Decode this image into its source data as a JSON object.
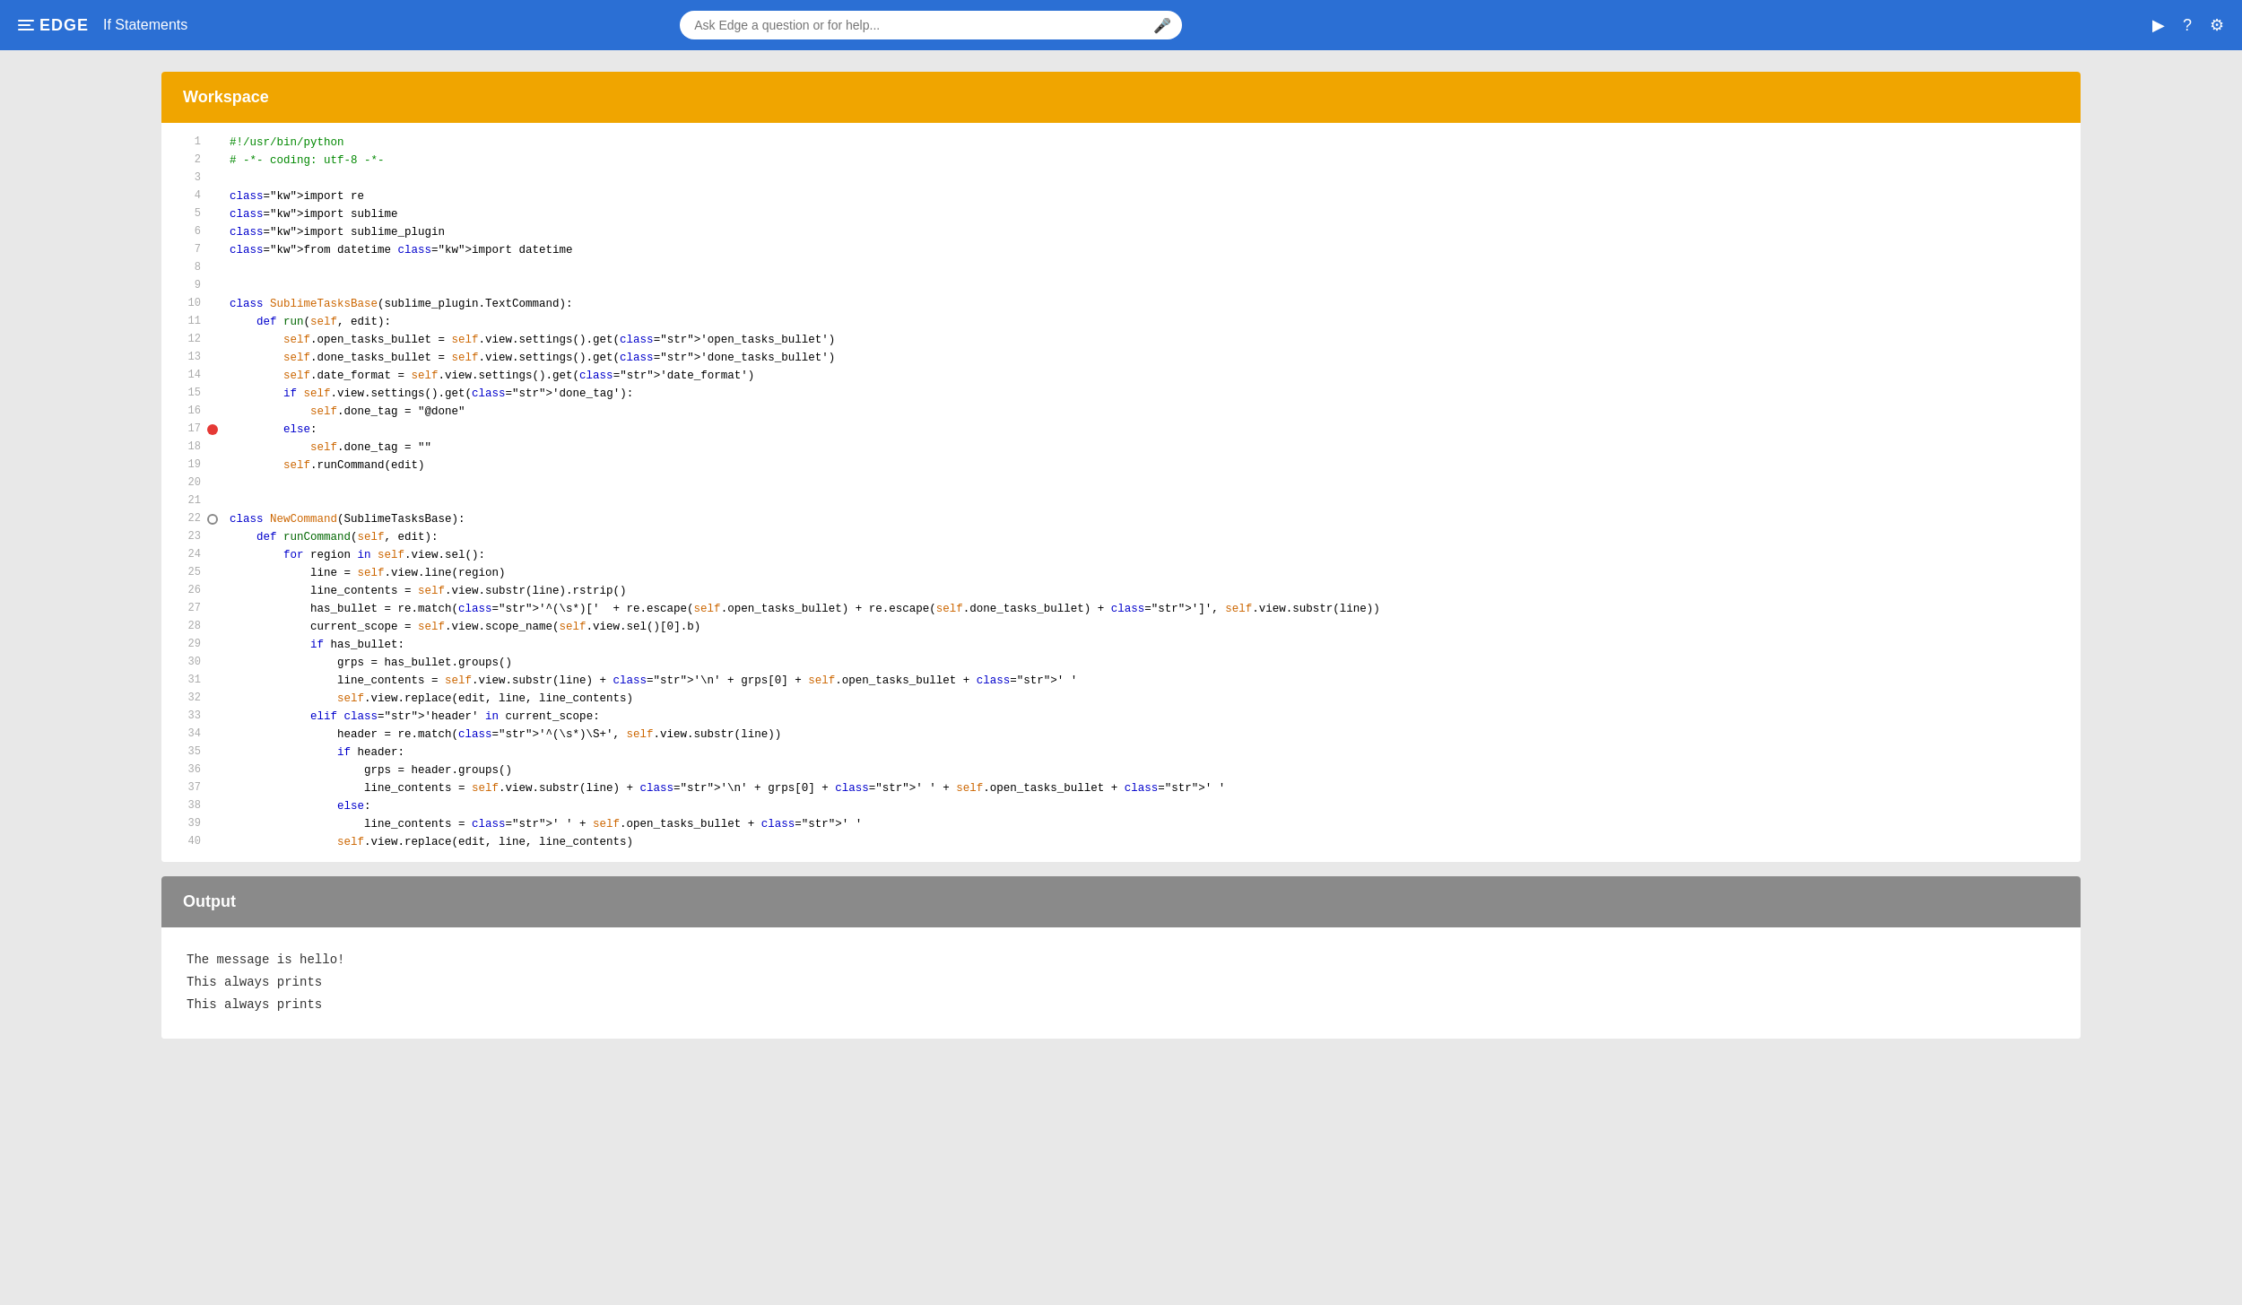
{
  "header": {
    "logo_text": "EDGE",
    "title": "If Statements",
    "search_placeholder": "Ask Edge a question or for help...",
    "play_icon": "▶",
    "help_icon": "?",
    "settings_icon": "⚙"
  },
  "workspace": {
    "panel_title": "Workspace"
  },
  "output": {
    "panel_title": "Output",
    "lines": [
      "The message is hello!",
      "This always prints",
      "This always prints"
    ]
  },
  "code": {
    "lines": [
      {
        "num": 1,
        "icon": null,
        "content": "#!/usr/bin/python"
      },
      {
        "num": 2,
        "icon": null,
        "content": "# -*- coding: utf-8 -*-"
      },
      {
        "num": 3,
        "icon": null,
        "content": ""
      },
      {
        "num": 4,
        "icon": null,
        "content": "import re"
      },
      {
        "num": 5,
        "icon": null,
        "content": "import sublime"
      },
      {
        "num": 6,
        "icon": null,
        "content": "import sublime_plugin"
      },
      {
        "num": 7,
        "icon": null,
        "content": "from datetime import datetime"
      },
      {
        "num": 8,
        "icon": null,
        "content": ""
      },
      {
        "num": 9,
        "icon": null,
        "content": ""
      },
      {
        "num": 10,
        "icon": null,
        "content": "class SublimeTasksBase(sublime_plugin.TextCommand):"
      },
      {
        "num": 11,
        "icon": null,
        "content": "    def run(self, edit):"
      },
      {
        "num": 12,
        "icon": null,
        "content": "        self.open_tasks_bullet = self.view.settings().get('open_tasks_bullet')"
      },
      {
        "num": 13,
        "icon": null,
        "content": "        self.done_tasks_bullet = self.view.settings().get('done_tasks_bullet')"
      },
      {
        "num": 14,
        "icon": null,
        "content": "        self.date_format = self.view.settings().get('date_format')"
      },
      {
        "num": 15,
        "icon": null,
        "content": "        if self.view.settings().get('done_tag'):"
      },
      {
        "num": 16,
        "icon": null,
        "content": "            self.done_tag = \"@done\""
      },
      {
        "num": 17,
        "icon": "breakpoint",
        "content": "        else:"
      },
      {
        "num": 18,
        "icon": null,
        "content": "            self.done_tag = \"\""
      },
      {
        "num": 19,
        "icon": null,
        "content": "        self.runCommand(edit)"
      },
      {
        "num": 20,
        "icon": null,
        "content": ""
      },
      {
        "num": 21,
        "icon": null,
        "content": ""
      },
      {
        "num": 22,
        "icon": "info",
        "content": "class NewCommand(SublimeTasksBase):"
      },
      {
        "num": 23,
        "icon": null,
        "content": "    def runCommand(self, edit):"
      },
      {
        "num": 24,
        "icon": null,
        "content": "        for region in self.view.sel():"
      },
      {
        "num": 25,
        "icon": null,
        "content": "            line = self.view.line(region)"
      },
      {
        "num": 26,
        "icon": null,
        "content": "            line_contents = self.view.substr(line).rstrip()"
      },
      {
        "num": 27,
        "icon": null,
        "content": "            has_bullet = re.match('^(\\s*)['  + re.escape(self.open_tasks_bullet) + re.escape(self.done_tasks_bullet) + ']', self.view.substr(line))"
      },
      {
        "num": 28,
        "icon": null,
        "content": "            current_scope = self.view.scope_name(self.view.sel()[0].b)"
      },
      {
        "num": 29,
        "icon": null,
        "content": "            if has_bullet:"
      },
      {
        "num": 30,
        "icon": null,
        "content": "                grps = has_bullet.groups()"
      },
      {
        "num": 31,
        "icon": null,
        "content": "                line_contents = self.view.substr(line) + '\\n' + grps[0] + self.open_tasks_bullet + ' '"
      },
      {
        "num": 32,
        "icon": null,
        "content": "                self.view.replace(edit, line, line_contents)"
      },
      {
        "num": 33,
        "icon": null,
        "content": "            elif 'header' in current_scope:"
      },
      {
        "num": 34,
        "icon": null,
        "content": "                header = re.match('^(\\s*)\\S+', self.view.substr(line))"
      },
      {
        "num": 35,
        "icon": null,
        "content": "                if header:"
      },
      {
        "num": 36,
        "icon": null,
        "content": "                    grps = header.groups()"
      },
      {
        "num": 37,
        "icon": null,
        "content": "                    line_contents = self.view.substr(line) + '\\n' + grps[0] + ' ' + self.open_tasks_bullet + ' '"
      },
      {
        "num": 38,
        "icon": null,
        "content": "                else:"
      },
      {
        "num": 39,
        "icon": null,
        "content": "                    line_contents = ' ' + self.open_tasks_bullet + ' '"
      },
      {
        "num": 40,
        "icon": null,
        "content": "                self.view.replace(edit, line, line_contents)"
      }
    ]
  }
}
